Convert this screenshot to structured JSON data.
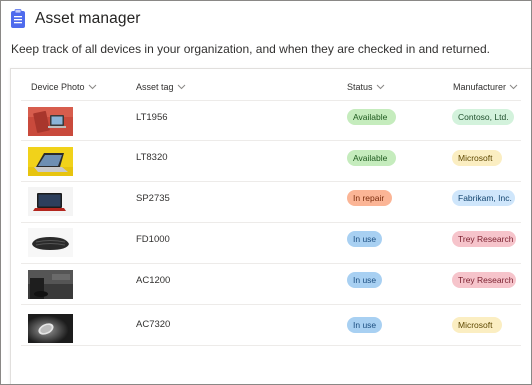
{
  "app": {
    "title": "Asset manager",
    "icon": "clipboard-list-icon"
  },
  "subtitle": "Keep track of all devices in your organization, and when they are checked in and returned.",
  "columns": [
    {
      "key": "photo",
      "label": "Device Photo"
    },
    {
      "key": "tag",
      "label": "Asset tag"
    },
    {
      "key": "status",
      "label": "Status"
    },
    {
      "key": "manufacturer",
      "label": "Manufacturer"
    }
  ],
  "rows": [
    {
      "photo": "red-laptop-photo",
      "tag": "LT1956",
      "status": "Available",
      "manufacturer": "Contoso, Ltd."
    },
    {
      "photo": "yellow-laptop-photo",
      "tag": "LT8320",
      "status": "Available",
      "manufacturer": "Microsoft"
    },
    {
      "photo": "red-tablet-photo",
      "tag": "SP2735",
      "status": "In repair",
      "manufacturer": "Fabrikam, Inc."
    },
    {
      "photo": "keyboard-photo",
      "tag": "FD1000",
      "status": "In use",
      "manufacturer": "Trey Research"
    },
    {
      "photo": "dark-device-photo",
      "tag": "AC1200",
      "status": "In use",
      "manufacturer": "Trey Research"
    },
    {
      "photo": "mouse-photo",
      "tag": "AC7320",
      "status": "In use",
      "manufacturer": "Microsoft"
    }
  ],
  "colors": {
    "available": {
      "bg": "#c5ecbd",
      "fg": "#1e5a1e"
    },
    "in_repair": {
      "bg": "#fbb596",
      "fg": "#7a2c0c"
    },
    "in_use": {
      "bg": "#a8d0f2",
      "fg": "#1c4e80"
    },
    "contoso": {
      "bg": "#d3f2dc",
      "fg": "#1f4f2c"
    },
    "microsoft": {
      "bg": "#fbeec2",
      "fg": "#5e4800"
    },
    "fabrikam": {
      "bg": "#cfe6fb",
      "fg": "#13456f"
    },
    "trey": {
      "bg": "#f6c4cb",
      "fg": "#7a1f2e"
    },
    "app_icon": "#4f6bed"
  }
}
